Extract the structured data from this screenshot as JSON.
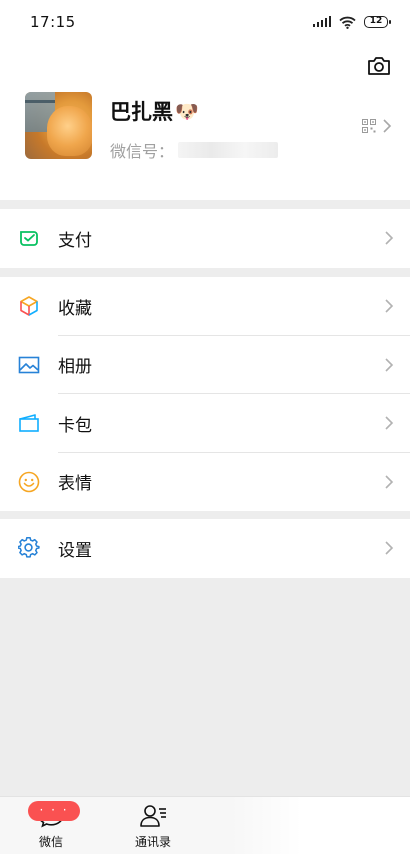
{
  "status_bar": {
    "time": "17:15",
    "battery": "12"
  },
  "profile": {
    "nickname": "巴扎黑",
    "nickname_emoji": "🐶",
    "wechat_id_label": "微信号："
  },
  "menu": {
    "pay": "支付",
    "favorites": "收藏",
    "album": "相册",
    "cards": "卡包",
    "stickers": "表情",
    "settings": "设置"
  },
  "tab_bar": {
    "chats_label": "微信",
    "chats_badge": "· · ·",
    "contacts_label": "通讯录"
  },
  "colors": {
    "pay_green": "#07c160",
    "album_blue": "#2782d7",
    "cards_blue": "#10aeff",
    "stickers_yellow": "#f6a623",
    "settings_blue": "#2782d7",
    "badge_red": "#fa5151"
  }
}
